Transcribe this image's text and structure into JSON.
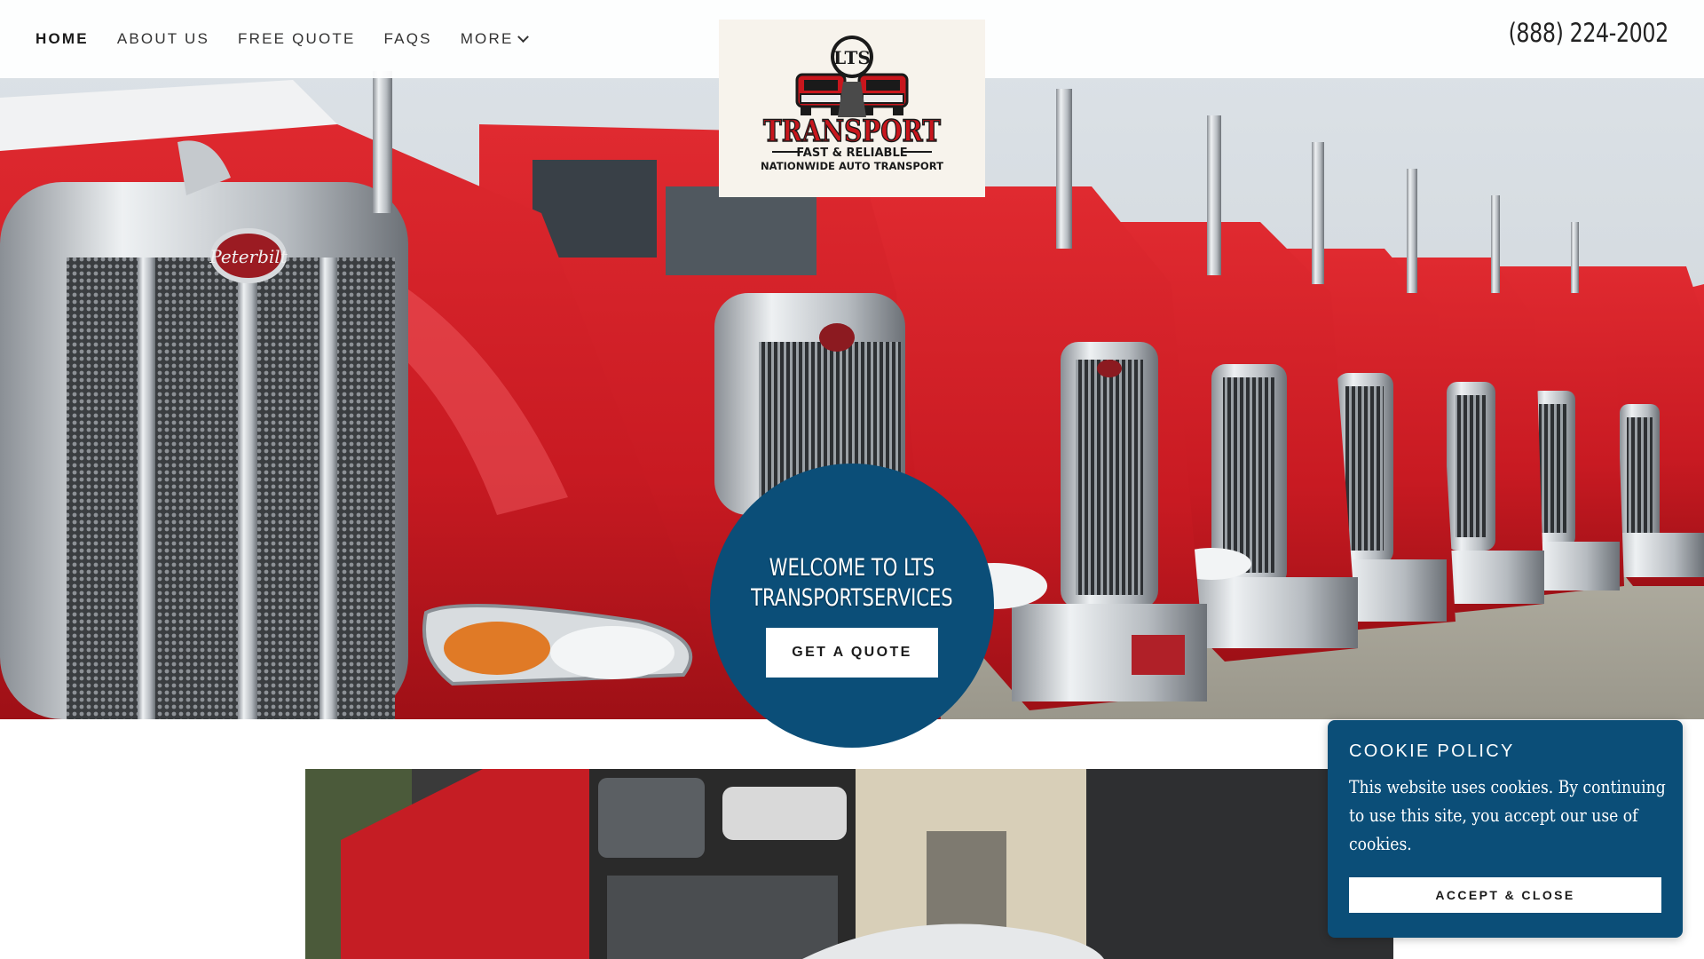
{
  "nav": {
    "items": [
      {
        "label": "HOME",
        "active": true
      },
      {
        "label": "ABOUT US"
      },
      {
        "label": "FREE QUOTE"
      },
      {
        "label": "FAQS"
      },
      {
        "label": "MORE"
      }
    ]
  },
  "phone": "(888) 224-2002",
  "logo": {
    "badge": "LTS",
    "title": "TRANSPORT",
    "tagline": "FAST & RELIABLE",
    "subline": "NATIONWIDE AUTO TRANSPORT"
  },
  "hero": {
    "heading_line1": "WELCOME TO LTS",
    "heading_line2": "TRANSPORTSERVICES",
    "cta_label": "GET A QUOTE",
    "grille_brand": "Peterbilt"
  },
  "cookie": {
    "title": "COOKIE POLICY",
    "body": "This website uses cookies. By continuing to use this site, you accept our use of cookies.",
    "accept_label": "ACCEPT & CLOSE"
  },
  "colors": {
    "brand_blue": "#0b4e78",
    "truck_red": "#d21f26"
  }
}
